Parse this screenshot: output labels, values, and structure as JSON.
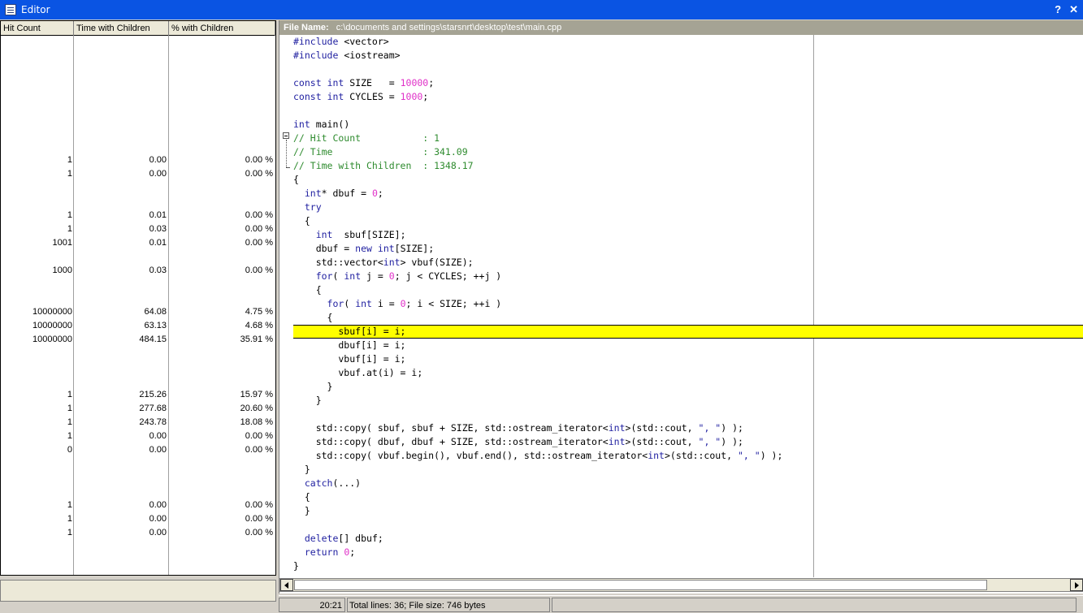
{
  "window": {
    "title": "Editor",
    "help_label": "?",
    "close_label": "✕"
  },
  "columns": {
    "hit_count": "Hit Count",
    "time_children": "Time with Children",
    "pct_children": "% with Children"
  },
  "stats": [
    {
      "line": 10,
      "hit": "1",
      "time": "0.00",
      "pct": "0.00 %"
    },
    {
      "line": 11,
      "hit": "1",
      "time": "0.00",
      "pct": "0.00 %"
    },
    {
      "line": 14,
      "hit": "1",
      "time": "0.01",
      "pct": "0.00 %"
    },
    {
      "line": 15,
      "hit": "1",
      "time": "0.03",
      "pct": "0.00 %"
    },
    {
      "line": 16,
      "hit": "1001",
      "time": "0.01",
      "pct": "0.00 %"
    },
    {
      "line": 18,
      "hit": "1000",
      "time": "0.03",
      "pct": "0.00 %"
    },
    {
      "line": 21,
      "hit": "10000000",
      "time": "64.08",
      "pct": "4.75 %"
    },
    {
      "line": 22,
      "hit": "10000000",
      "time": "63.13",
      "pct": "4.68 %"
    },
    {
      "line": 23,
      "hit": "10000000",
      "time": "484.15",
      "pct": "35.91 %"
    },
    {
      "line": 27,
      "hit": "1",
      "time": "215.26",
      "pct": "15.97 %"
    },
    {
      "line": 28,
      "hit": "1",
      "time": "277.68",
      "pct": "20.60 %"
    },
    {
      "line": 29,
      "hit": "1",
      "time": "243.78",
      "pct": "18.08 %"
    },
    {
      "line": 30,
      "hit": "1",
      "time": "0.00",
      "pct": "0.00 %"
    },
    {
      "line": 31,
      "hit": "0",
      "time": "0.00",
      "pct": "0.00 %"
    },
    {
      "line": 35,
      "hit": "1",
      "time": "0.00",
      "pct": "0.00 %"
    },
    {
      "line": 36,
      "hit": "1",
      "time": "0.00",
      "pct": "0.00 %"
    },
    {
      "line": 37,
      "hit": "1",
      "time": "0.00",
      "pct": "0.00 %"
    }
  ],
  "file": {
    "label": "File Name:",
    "path": "c:\\documents and settings\\starsnrt\\desktop\\test\\main.cpp"
  },
  "code_lines": [
    "#include <vector>",
    "#include <iostream>",
    "",
    "const int SIZE   = 10000;",
    "const int CYCLES = 1000;",
    "",
    "int main()",
    "// Hit Count           : 1",
    "// Time                : 341.09",
    "// Time with Children  : 1348.17",
    "{",
    "  int* dbuf = 0;",
    "  try",
    "  {",
    "    int  sbuf[SIZE];",
    "    dbuf = new int[SIZE];",
    "    std::vector<int> vbuf(SIZE);",
    "    for( int j = 0; j < CYCLES; ++j )",
    "    {",
    "      for( int i = 0; i < SIZE; ++i )",
    "      {",
    "        sbuf[i] = i;",
    "        dbuf[i] = i;",
    "        vbuf[i] = i;",
    "        vbuf.at(i) = i;",
    "      }",
    "    }",
    "",
    "    std::copy( sbuf, sbuf + SIZE, std::ostream_iterator<int>(std::cout, \", \") );",
    "    std::copy( dbuf, dbuf + SIZE, std::ostream_iterator<int>(std::cout, \", \") );",
    "    std::copy( vbuf.begin(), vbuf.end(), std::ostream_iterator<int>(std::cout, \", \") );",
    "  }",
    "  catch(...)",
    "  {",
    "  }",
    "",
    "  delete[] dbuf;",
    "  return 0;",
    "}"
  ],
  "highlighted_line": 22,
  "status": {
    "position": "20:21",
    "info": "Total lines: 36; File size: 746 bytes"
  },
  "colors": {
    "highlight": "#ffff00",
    "keyword": "#1f1fa0",
    "number": "#e030c8",
    "comment": "#2e8b2e",
    "title": "#0a54e3"
  }
}
